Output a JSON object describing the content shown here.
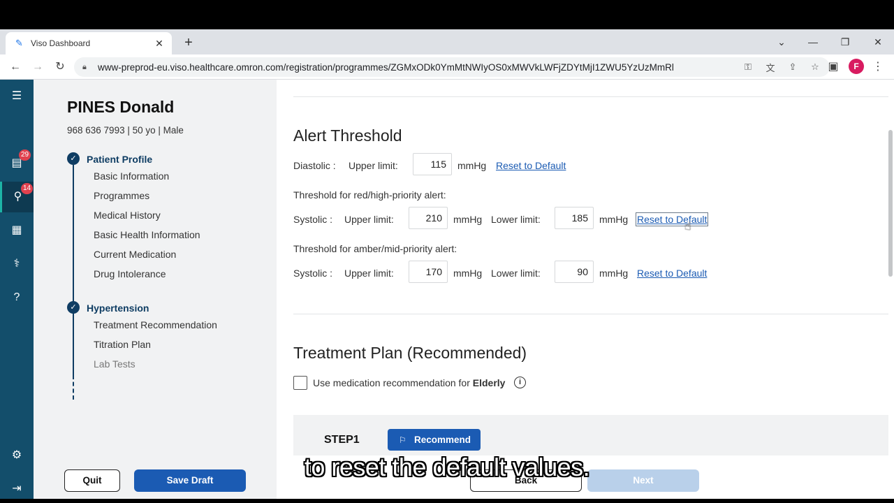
{
  "browser": {
    "tab_title": "Viso Dashboard",
    "url": "www-preprod-eu.viso.healthcare.omron.com/registration/programmes/ZGMxODk0YmMtNWIyOS0xMWVkLWFjZDYtMjI1ZWU5YzUzMmRl",
    "profile_initial": "F"
  },
  "rail": {
    "badge_reports": "29",
    "badge_patients": "14"
  },
  "patient": {
    "name": "PINES Donald",
    "meta": "968 636 7993 | 50 yo | Male"
  },
  "steps": {
    "patient_profile": {
      "title": "Patient Profile",
      "items": [
        "Basic Information",
        "Programmes",
        "Medical History",
        "Basic Health Information",
        "Current Medication",
        "Drug Intolerance"
      ]
    },
    "hypertension": {
      "title": "Hypertension",
      "items": [
        "Treatment Recommendation",
        "Titration Plan",
        "Lab Tests"
      ]
    }
  },
  "footer_left": {
    "quit": "Quit",
    "save_draft": "Save Draft"
  },
  "alert_threshold": {
    "title": "Alert Threshold",
    "diastolic_label": "Diastolic :",
    "upper_limit_label": "Upper limit:",
    "lower_limit_label": "Lower limit:",
    "unit": "mmHg",
    "reset_label": "Reset to Default",
    "diastolic_upper": "115",
    "red_heading": "Threshold for red/high-priority alert:",
    "systolic_label": "Systolic :",
    "red_upper": "210",
    "red_lower": "185",
    "amber_heading": "Threshold for amber/mid-priority alert:",
    "amber_upper": "170",
    "amber_lower": "90"
  },
  "treatment_plan": {
    "title": "Treatment Plan (Recommended)",
    "elderly_prefix": "Use medication recommendation for ",
    "elderly_bold": "Elderly",
    "info": "i",
    "step_label": "STEP1",
    "recommend": "Recommend"
  },
  "footer_main": {
    "back": "Back",
    "next": "Next"
  },
  "subtitle": "to reset the default values."
}
